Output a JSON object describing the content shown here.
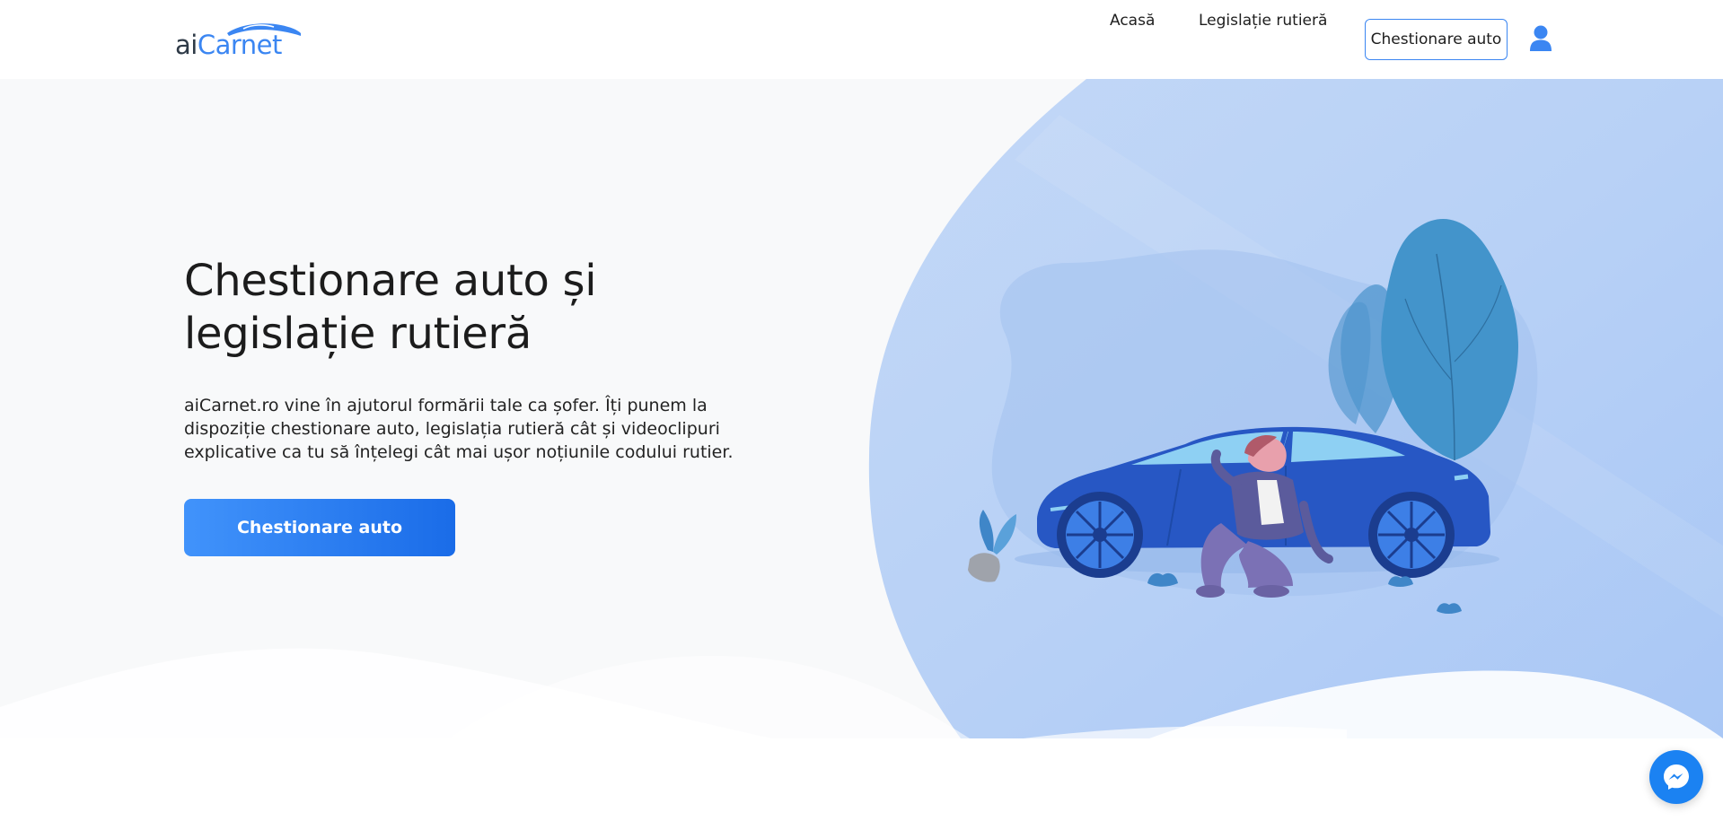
{
  "header": {
    "logo": {
      "part1": "ai",
      "part2": "Carnet"
    },
    "nav": {
      "home": "Acasă",
      "legislation": "Legislație rutieră",
      "quiz_button": "Chestionare auto"
    },
    "user_icon": "user-icon"
  },
  "hero": {
    "title": "Chestionare auto și legislație rutieră",
    "description": "aiCarnet.ro vine în ajutorul formării tale ca șofer. Îți punem la dispoziție chestionare auto, legislația rutieră cât și videoclipuri explicative ca tu să înțelegi cât mai ușor noțiunile codului rutier.",
    "cta_label": "Chestionare auto",
    "illustration": "car-with-person-illustration"
  },
  "widgets": {
    "messenger_icon": "messenger-icon"
  },
  "colors": {
    "accent": "#3b86f2",
    "cta_start": "#4193fb",
    "cta_end": "#1a6ce8",
    "hero_bg": "#f8f9fa",
    "blob": "#b3cff6"
  }
}
